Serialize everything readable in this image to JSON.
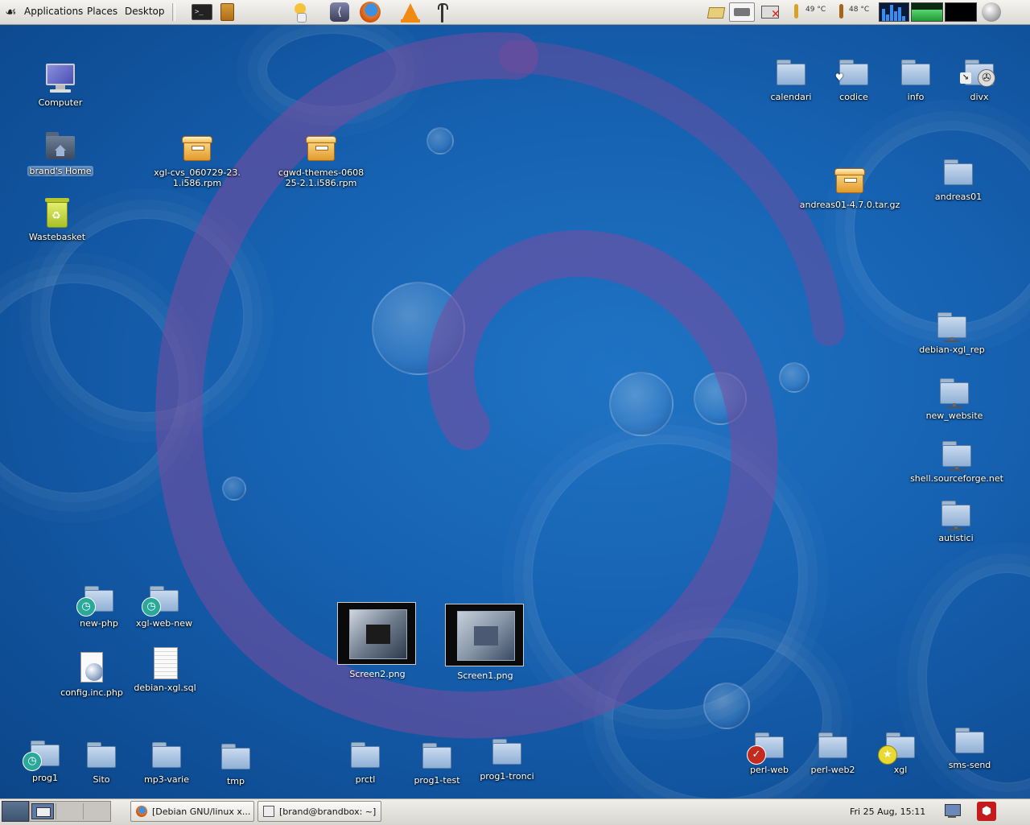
{
  "top_panel": {
    "menus": [
      "Applications",
      "Places",
      "Desktop"
    ],
    "launchers": [
      "terminal-icon",
      "notes-icon",
      "gaim-icon",
      "emacs-icon",
      "firefox-icon",
      "vlc-icon",
      "tool-icon"
    ],
    "tray": {
      "temp1": "49 °C",
      "temp2": "48 °C"
    }
  },
  "desktop": {
    "icons_left": [
      {
        "label": "Computer",
        "icon": "computer-icon"
      },
      {
        "label": "brand's Home",
        "icon": "home-folder-icon",
        "selected": true
      },
      {
        "label": "Wastebasket",
        "icon": "trash-icon"
      }
    ],
    "packages": [
      {
        "label": "xgl-cvs_060729-23.1.i586.rpm"
      },
      {
        "label": "cgwd-themes-060825-2.1.i586.rpm"
      },
      {
        "label": "andreas01-4.7.0.tar.gz"
      }
    ],
    "folders_top_right": [
      {
        "label": "calendari"
      },
      {
        "label": "codice"
      },
      {
        "label": "info"
      },
      {
        "label": "divx"
      },
      {
        "label": "andreas01"
      }
    ],
    "network_folders": [
      {
        "label": "debian-xgl_rep"
      },
      {
        "label": "new_website"
      },
      {
        "label": "shell.sourceforge.net"
      },
      {
        "label": "autistici"
      }
    ],
    "link_folders": [
      {
        "label": "new-php"
      },
      {
        "label": "xgl-web-new"
      }
    ],
    "files": [
      {
        "label": "config.inc.php"
      },
      {
        "label": "debian-xgl.sql"
      }
    ],
    "images": [
      {
        "label": "Screen2.png"
      },
      {
        "label": "Screen1.png"
      }
    ],
    "folders_bottom": [
      {
        "label": "prog1"
      },
      {
        "label": "Sito"
      },
      {
        "label": "mp3-varie"
      },
      {
        "label": "tmp"
      },
      {
        "label": "prctl"
      },
      {
        "label": "prog1-test"
      },
      {
        "label": "prog1-tronci"
      },
      {
        "label": "perl-web"
      },
      {
        "label": "perl-web2"
      },
      {
        "label": "xgl"
      },
      {
        "label": "sms-send"
      }
    ]
  },
  "bottom_panel": {
    "tasks": [
      {
        "label": "[Debian GNU/linux x..."
      },
      {
        "label": "[brand@brandbox: ~]"
      }
    ],
    "clock": "Fri 25 Aug, 15:11"
  },
  "colors": {
    "desktop_bg": "#1763b3",
    "swirl": "#7c4a9c",
    "panel": "#e6e4df"
  }
}
